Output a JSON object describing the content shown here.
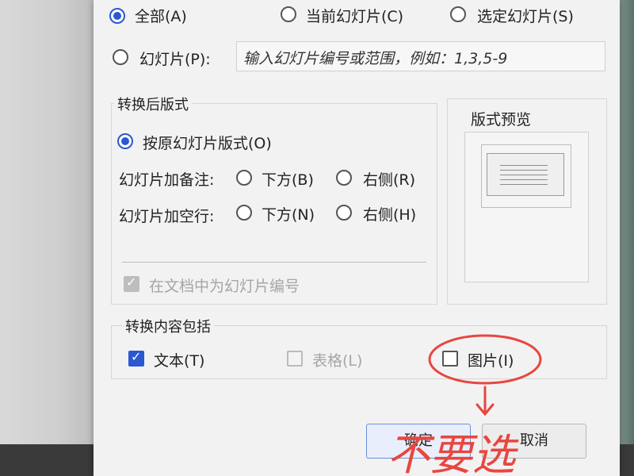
{
  "scope": {
    "all_label": "全部(A)",
    "current_label": "当前幻灯片(C)",
    "selected_label": "选定幻灯片(S)",
    "slides_label": "幻灯片(P):",
    "range_placeholder": "输入幻灯片编号或范围，例如：1,3,5-9"
  },
  "layout_group": {
    "title": "转换后版式",
    "original_label": "按原幻灯片版式(O)",
    "notes_label": "幻灯片加备注:",
    "notes_below": "下方(B)",
    "notes_right": "右侧(R)",
    "blank_label": "幻灯片加空行:",
    "blank_below": "下方(N)",
    "blank_right": "右侧(H)",
    "number_label": "在文档中为幻灯片编号"
  },
  "preview": {
    "title": "版式预览"
  },
  "content_group": {
    "title": "转换内容包括",
    "text_label": "文本(T)",
    "table_label": "表格(L)",
    "image_label": "图片(I)"
  },
  "buttons": {
    "ok": "确定",
    "cancel": "取消"
  },
  "annotation": {
    "handwriting": "不要选",
    "color": "#e8463f"
  }
}
